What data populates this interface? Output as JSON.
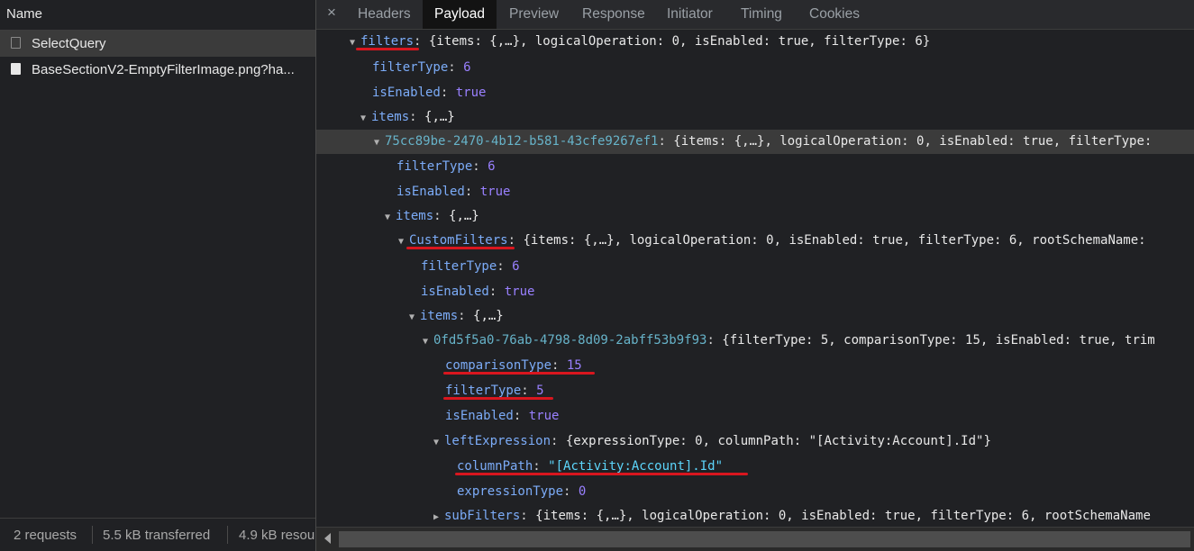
{
  "left": {
    "header": "Name",
    "requests": [
      "SelectQuery",
      "BaseSectionV2-EmptyFilterImage.png?ha..."
    ],
    "status": [
      "2 requests",
      "5.5 kB transferred",
      "4.9 kB resou"
    ]
  },
  "tabs": {
    "close": "×",
    "items": [
      "Headers",
      "Payload",
      "Preview",
      "Response",
      "Initiator",
      "Timing",
      "Cookies"
    ],
    "active": "Payload"
  },
  "tree": [
    {
      "arrow": "▼",
      "key": "filters",
      "summary": "{items: {,…}, logicalOperation: 0, isEnabled: true, filterType: 6}"
    },
    {
      "key": "filterType",
      "value": "6",
      "vtype": "num"
    },
    {
      "key": "isEnabled",
      "value": "true",
      "vtype": "bool"
    },
    {
      "arrow": "▼",
      "key": "items",
      "summary": "{,…}"
    },
    {
      "arrow": "▼",
      "key": "75cc89be-2470-4b12-b581-43cfe9267ef1",
      "summary": "{items: {,…}, logicalOperation: 0, isEnabled: true, filterType:"
    },
    {
      "key": "filterType",
      "value": "6",
      "vtype": "num"
    },
    {
      "key": "isEnabled",
      "value": "true",
      "vtype": "bool"
    },
    {
      "arrow": "▼",
      "key": "items",
      "summary": "{,…}"
    },
    {
      "arrow": "▼",
      "key": "CustomFilters",
      "summary": "{items: {,…}, logicalOperation: 0, isEnabled: true, filterType: 6, rootSchemaName:"
    },
    {
      "key": "filterType",
      "value": "6",
      "vtype": "num"
    },
    {
      "key": "isEnabled",
      "value": "true",
      "vtype": "bool"
    },
    {
      "arrow": "▼",
      "key": "items",
      "summary": "{,…}"
    },
    {
      "arrow": "▼",
      "key": "0fd5f5a0-76ab-4798-8d09-2abff53b9f93",
      "summary": "{filterType: 5, comparisonType: 15, isEnabled: true, trim"
    },
    {
      "key": "comparisonType",
      "value": "15",
      "vtype": "num"
    },
    {
      "key": "filterType",
      "value": "5",
      "vtype": "num"
    },
    {
      "key": "isEnabled",
      "value": "true",
      "vtype": "bool"
    },
    {
      "arrow": "▼",
      "key": "leftExpression",
      "summary": "{expressionType: 0, columnPath: \"[Activity:Account].Id\"}"
    },
    {
      "key": "columnPath",
      "value": "\"[Activity:Account].Id\"",
      "vtype": "str"
    },
    {
      "key": "expressionType",
      "value": "0",
      "vtype": "num"
    },
    {
      "arrow": "▶",
      "key": "subFilters",
      "summary": "{items: {,…}, logicalOperation: 0, isEnabled: true, filterType: 6, rootSchemaName"
    }
  ],
  "colors": {
    "background": "#202124",
    "key": "#7cacf8",
    "number": "#9980ff",
    "string": "#5cd5fb",
    "annotation": "#d9161e"
  }
}
